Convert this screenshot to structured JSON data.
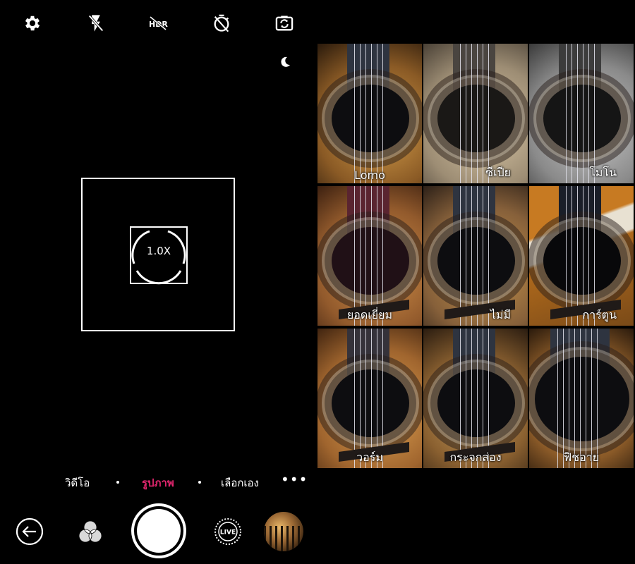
{
  "top_bar": {
    "icons": [
      "gear-icon",
      "flash-off-icon",
      "hdr-off-icon",
      "timer-off-icon",
      "switch-camera-icon"
    ],
    "night_icon": "moon-icon"
  },
  "viewfinder": {
    "zoom_label": "1.0X"
  },
  "modes": [
    {
      "label": "วิดีโอ",
      "active": false
    },
    {
      "label": "รูปภาพ",
      "active": true
    },
    {
      "label": "เลือกเอง",
      "active": false
    }
  ],
  "more_label": "•••",
  "colors": {
    "accent": "#e2266e",
    "background": "#000000",
    "foreground": "#ffffff"
  },
  "bottom_bar": {
    "icons": [
      "back-icon",
      "filters-icon",
      "shutter-button",
      "live-icon",
      "gallery-thumbnail"
    ],
    "live_label": "LIVE"
  },
  "filters": [
    {
      "label": "Lomo"
    },
    {
      "label": "ซีเปีย"
    },
    {
      "label": "โมโน"
    },
    {
      "label": "ยอดเยี่ยม"
    },
    {
      "label": "ไม่มี"
    },
    {
      "label": "การ์ตูน"
    },
    {
      "label": "วอร์ม"
    },
    {
      "label": "กระจกส่อง"
    },
    {
      "label": "ฟิชอาย"
    }
  ]
}
